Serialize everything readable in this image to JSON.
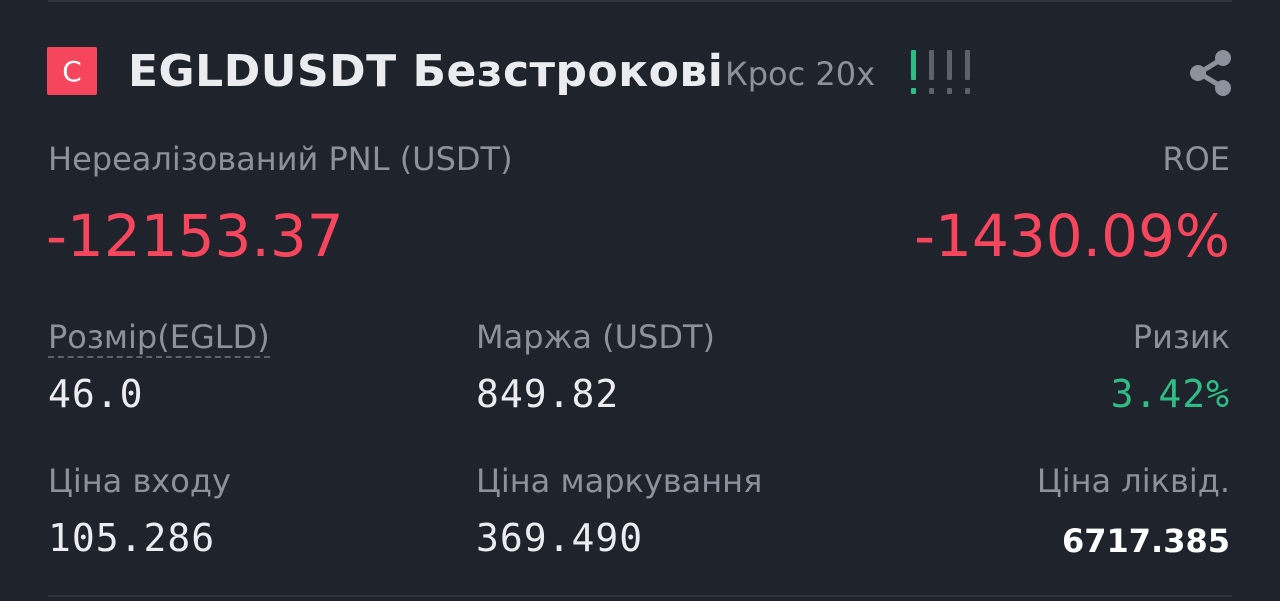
{
  "header": {
    "badge": "C",
    "symbol": "EGLDUSDT Безстрокові",
    "mode": "Крос 20х",
    "risk_level": 0.25,
    "share_icon": "share-icon"
  },
  "pnl": {
    "label": "Нереалізований PNL (USDT)",
    "value": "-12153.37"
  },
  "roe": {
    "label": "ROE",
    "value": "-1430.09%"
  },
  "stats": {
    "size_label": "Розмір(EGLD)",
    "size_value": "46.0",
    "margin_label": "Маржа (USDT)",
    "margin_value": "849.82",
    "risk_label": "Ризик",
    "risk_value": "3.42%",
    "entry_label": "Ціна входу",
    "entry_value": "105.286",
    "mark_label": "Ціна маркування",
    "mark_value": "369.490",
    "liq_label": "Ціна ліквід.",
    "liq_value": "6717.385"
  },
  "colors": {
    "background": "#1f232b",
    "negative": "#f6465d",
    "positive": "#2ebd85",
    "muted": "#8b929c",
    "text": "#eaecef"
  }
}
